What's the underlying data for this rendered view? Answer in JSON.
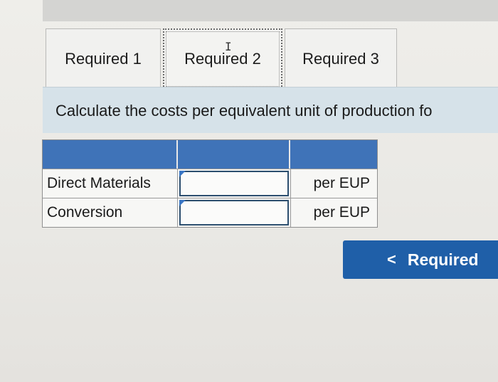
{
  "tabs": [
    {
      "label": "Required 1"
    },
    {
      "label": "Required 2"
    },
    {
      "label": "Required 3"
    }
  ],
  "instruction": "Calculate the costs per equivalent unit of production fo",
  "table": {
    "header": [
      "",
      "",
      ""
    ],
    "rows": [
      {
        "label": "Direct Materials",
        "value": "",
        "unit": "per EUP"
      },
      {
        "label": "Conversion",
        "value": "",
        "unit": "per EUP"
      }
    ]
  },
  "nav": {
    "prev_label": "Required",
    "chevron": "<"
  },
  "colors": {
    "header_blue": "#3f73b8",
    "button_blue": "#1f5fa8",
    "instruction_band": "#d6e2e9"
  },
  "icons": {
    "cursor": "text-cursor-icon",
    "chevron": "chevron-left-icon"
  }
}
